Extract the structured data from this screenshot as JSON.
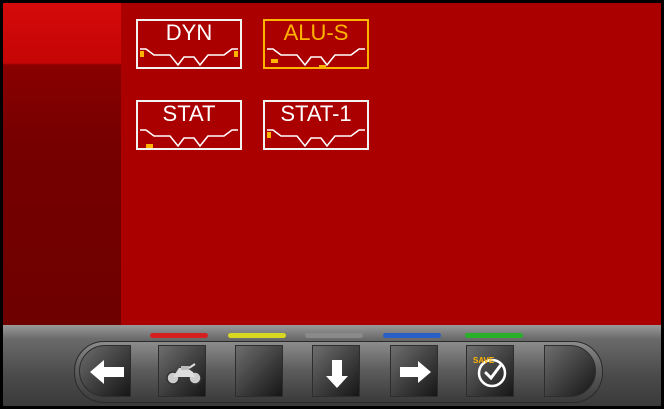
{
  "programs": [
    {
      "label": "DYN",
      "selected": false
    },
    {
      "label": "ALU-S",
      "selected": true
    },
    {
      "label": "STAT",
      "selected": false
    },
    {
      "label": "STAT-1",
      "selected": false
    }
  ],
  "colors": {
    "background": "#aa0000",
    "accent_selected": "#ffb400",
    "stripe_red": "#d42020",
    "stripe_yellow": "#d8d820",
    "stripe_gray": "#8a8a8a",
    "stripe_blue": "#2860c8",
    "stripe_green": "#28b028"
  },
  "toolbar": {
    "keys": [
      {
        "name": "left-arrow-icon"
      },
      {
        "name": "motorcycle-icon"
      },
      {
        "name": "blank-key"
      },
      {
        "name": "down-arrow-icon"
      },
      {
        "name": "right-arrow-icon"
      },
      {
        "name": "save-check-icon",
        "label": "SAVE"
      },
      {
        "name": "blank-key"
      }
    ]
  }
}
